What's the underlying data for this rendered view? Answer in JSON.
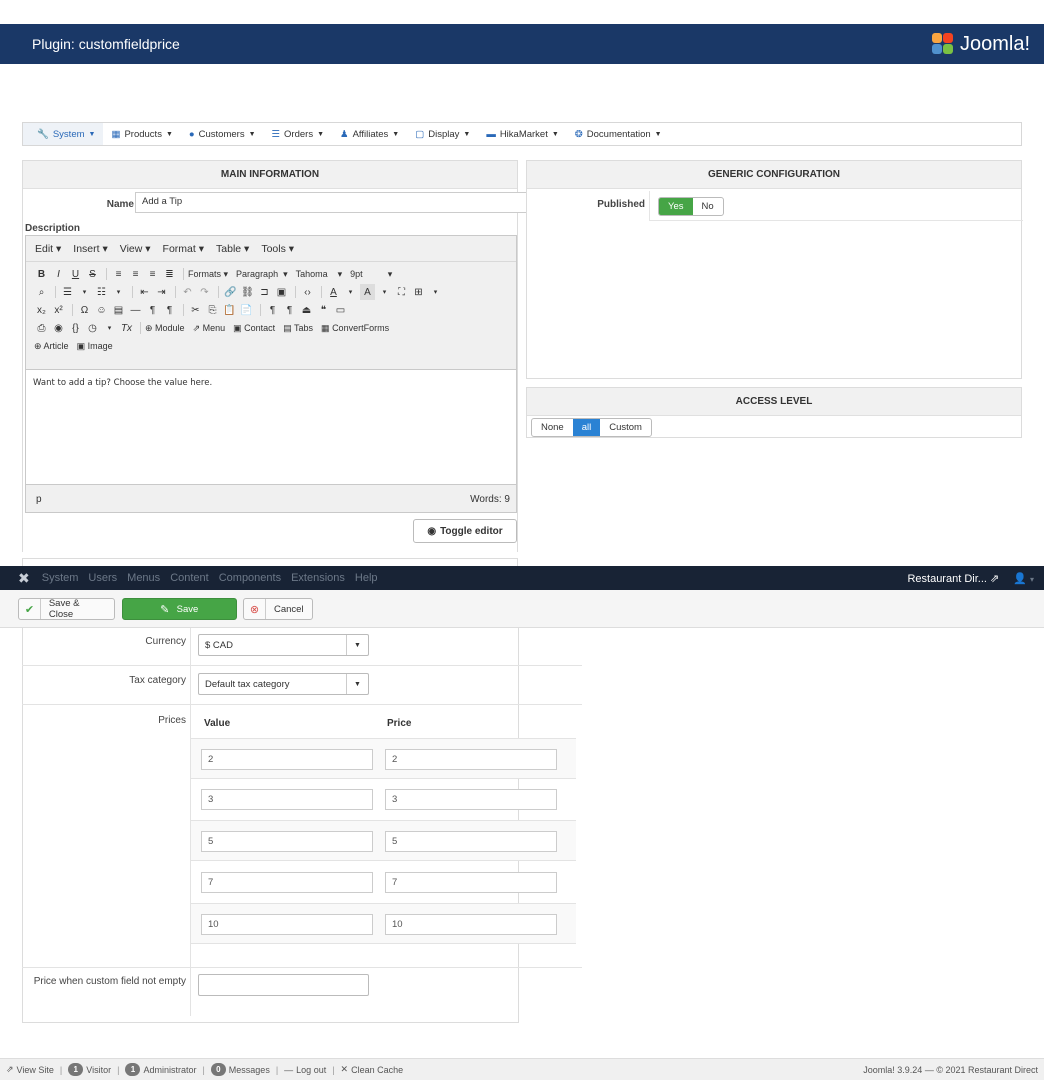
{
  "header": {
    "title": "Plugin: customfieldprice",
    "brand": "Joomla!"
  },
  "hika_menu": [
    {
      "label": "System",
      "icon": "wrench-icon"
    },
    {
      "label": "Products",
      "icon": "cubes-icon"
    },
    {
      "label": "Customers",
      "icon": "user-icon"
    },
    {
      "label": "Orders",
      "icon": "list-icon"
    },
    {
      "label": "Affiliates",
      "icon": "users-icon"
    },
    {
      "label": "Display",
      "icon": "monitor-icon"
    },
    {
      "label": "HikaMarket",
      "icon": "store-icon"
    },
    {
      "label": "Documentation",
      "icon": "lifebuoy-icon"
    }
  ],
  "main_information": {
    "heading": "MAIN INFORMATION",
    "name_label": "Name",
    "name_value": "Add a Tip",
    "description_label": "Description",
    "editor_menu": [
      "Edit",
      "Insert",
      "View",
      "Format",
      "Table",
      "Tools"
    ],
    "toolbar": {
      "formats": "Formats",
      "paragraph": "Paragraph",
      "font": "Tahoma",
      "size": "9pt",
      "module": "Module",
      "menu": "Menu",
      "contact": "Contact",
      "tabs": "Tabs",
      "convertforms": "ConvertForms",
      "article": "Article",
      "image": "Image"
    },
    "editor_content": "Want to add a tip? Choose the value here.",
    "status_path": "p",
    "word_count": "Words: 9",
    "toggle_editor": "Toggle editor"
  },
  "generic_configuration": {
    "heading": "GENERIC CONFIGURATION",
    "published_label": "Published",
    "yes": "Yes",
    "no": "No"
  },
  "access_level": {
    "heading": "ACCESS LEVEL",
    "none": "None",
    "all": "all",
    "custom": "Custom"
  },
  "admin_bar": {
    "nav": [
      "System",
      "Users",
      "Menus",
      "Content",
      "Components",
      "Extensions",
      "Help"
    ],
    "site_name": "Restaurant Dir..."
  },
  "toolbar": {
    "save_close": "Save & Close",
    "save": "Save",
    "cancel": "Cancel"
  },
  "form": {
    "currency_label": "Currency",
    "currency_value": "$ CAD",
    "tax_label": "Tax category",
    "tax_value": "Default tax category",
    "prices_label": "Prices",
    "value_header": "Value",
    "price_header": "Price",
    "prices": [
      {
        "value": "2",
        "price": "2"
      },
      {
        "value": "3",
        "price": "3"
      },
      {
        "value": "5",
        "price": "5"
      },
      {
        "value": "7",
        "price": "7"
      },
      {
        "value": "10",
        "price": "10"
      }
    ],
    "empty_label": "Price when custom field not empty",
    "empty_value": ""
  },
  "status_bar": {
    "view_site": "View Site",
    "visitor_count": "1",
    "visitor": "Visitor",
    "admin_count": "1",
    "administrator": "Administrator",
    "messages_count": "0",
    "messages": "Messages",
    "logout": "Log out",
    "clean_cache": "Clean Cache",
    "copyright": "Joomla! 3.9.24 — © 2021 Restaurant Direct"
  },
  "colors": {
    "header_bg": "#1a3867",
    "admin_bar_bg": "#182335",
    "green": "#46a546",
    "blue": "#2a82d4"
  }
}
